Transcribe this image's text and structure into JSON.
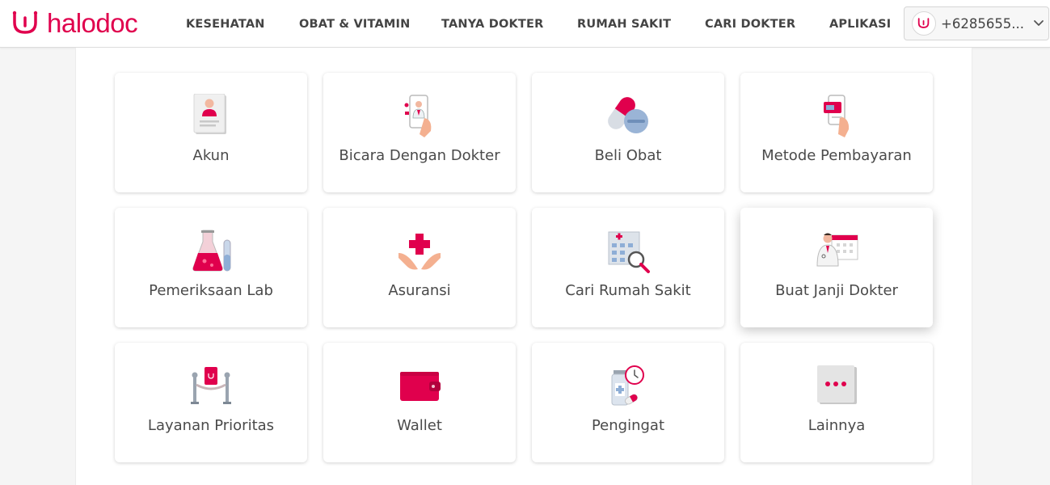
{
  "brand": {
    "name": "halodoc",
    "accent": "#e0004d"
  },
  "nav": [
    {
      "label": "KESEHATAN"
    },
    {
      "label": "OBAT & VITAMIN"
    },
    {
      "label": "TANYA DOKTER"
    },
    {
      "label": "RUMAH SAKIT"
    },
    {
      "label": "CARI DOKTER"
    },
    {
      "label": "APLIKASI"
    }
  ],
  "account": {
    "phone": "+6285655...",
    "avatar_icon": "stethoscope-icon",
    "chevron_icon": "chevron-down-icon"
  },
  "menu": [
    {
      "label": "Akun",
      "icon": "account-profile-icon"
    },
    {
      "label": "Bicara Dengan Dokter",
      "icon": "talk-to-doctor-icon"
    },
    {
      "label": "Beli Obat",
      "icon": "pills-icon"
    },
    {
      "label": "Metode Pembayaran",
      "icon": "payment-method-icon"
    },
    {
      "label": "Pemeriksaan Lab",
      "icon": "lab-flask-icon"
    },
    {
      "label": "Asuransi",
      "icon": "insurance-hands-icon"
    },
    {
      "label": "Cari Rumah Sakit",
      "icon": "hospital-search-icon"
    },
    {
      "label": "Buat Janji Dokter",
      "icon": "doctor-appointment-icon"
    },
    {
      "label": "Layanan Prioritas",
      "icon": "priority-service-icon"
    },
    {
      "label": "Wallet",
      "icon": "wallet-icon"
    },
    {
      "label": "Pengingat",
      "icon": "reminder-icon"
    },
    {
      "label": "Lainnya",
      "icon": "more-icon"
    }
  ]
}
